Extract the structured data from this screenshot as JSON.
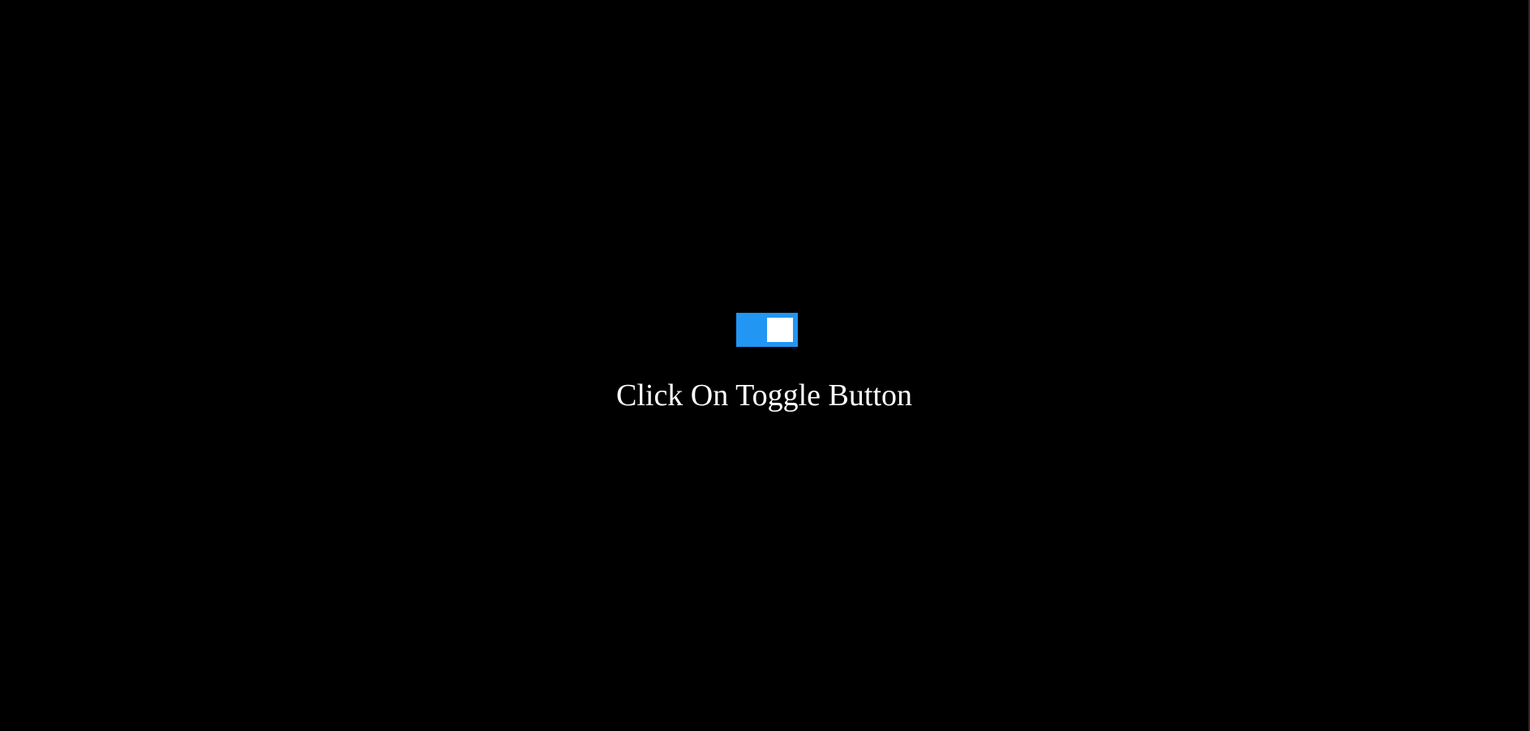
{
  "toggle": {
    "state": "on",
    "track_color": "#2196f3",
    "knob_color": "#ffffff"
  },
  "caption": "Click On Toggle Button",
  "background_color": "#000000"
}
